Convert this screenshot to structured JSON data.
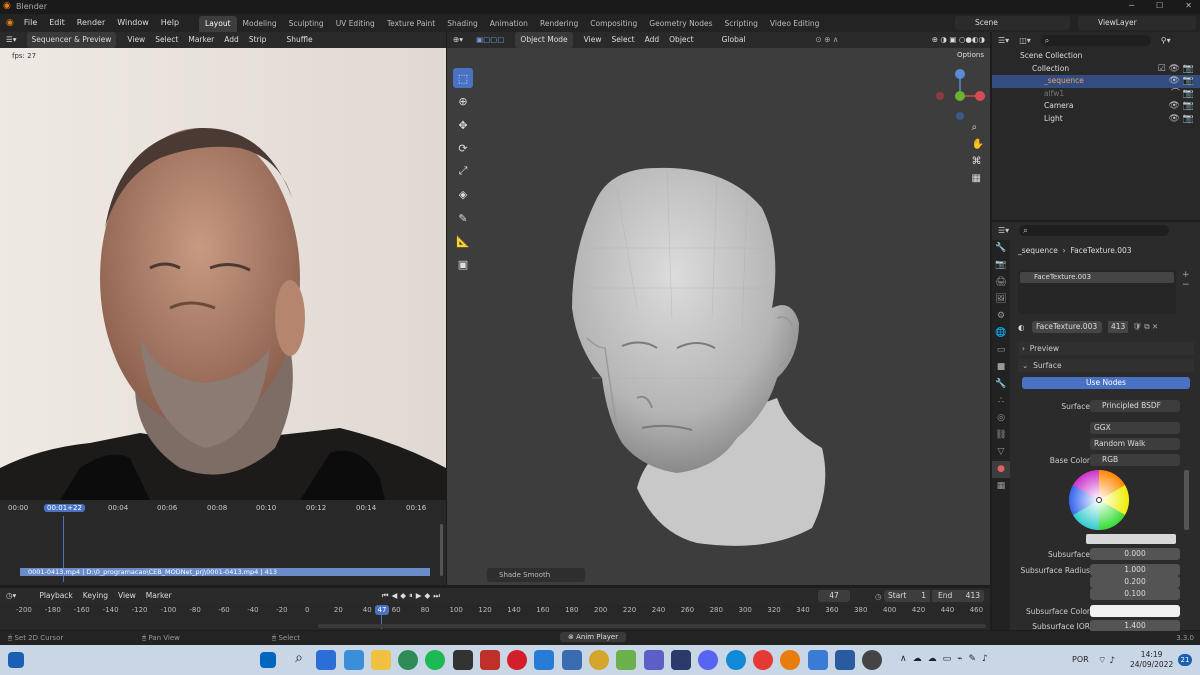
{
  "app": {
    "title": "Blender",
    "version": "3.3.0"
  },
  "menu": [
    "File",
    "Edit",
    "Render",
    "Window",
    "Help"
  ],
  "workspaces": [
    "Layout",
    "Modeling",
    "Sculpting",
    "UV Editing",
    "Texture Paint",
    "Shading",
    "Animation",
    "Rendering",
    "Compositing",
    "Geometry Nodes",
    "Scripting",
    "Video Editing"
  ],
  "active_workspace": "Layout",
  "scene": "Scene",
  "viewlayer": "ViewLayer",
  "seq": {
    "mode": "Sequencer & Preview",
    "menus": [
      "View",
      "Select",
      "Marker",
      "Add",
      "Strip"
    ],
    "shuffle": "Shuffle",
    "fps": "fps: 27",
    "ticks": [
      "00:00",
      "00:01+22",
      "00:04",
      "00:06",
      "00:08",
      "00:10",
      "00:12",
      "00:14",
      "00:16"
    ],
    "strip": "0001-0413.mp4 | D:\\0_programacao\\CEB_MODNet_prj\\0001-0413.mp4 | 413"
  },
  "vp": {
    "mode": "Object Mode",
    "menus": [
      "View",
      "Select",
      "Add",
      "Object"
    ],
    "orient": "Global",
    "options": "Options",
    "shade_popup": "Shade Smooth"
  },
  "outliner": {
    "root": "Scene Collection",
    "collection": "Collection",
    "items": [
      "_sequence",
      "alfw1",
      "Camera",
      "Light"
    ]
  },
  "props": {
    "object": "_sequence",
    "material": "FaceTexture.003",
    "slot": "FaceTexture.003",
    "users": "413",
    "preview": "Preview",
    "surface_hdr": "Surface",
    "use_nodes": "Use Nodes",
    "surface_label": "Surface",
    "surface_val": "Principled BSDF",
    "dist": "GGX",
    "sss_method": "Random Walk",
    "basecolor_label": "Base Color",
    "basecolor_val": "RGB",
    "subsurface_label": "Subsurface",
    "subsurface_val": "0.000",
    "ssr_label": "Subsurface Radius",
    "ssr": [
      "1.000",
      "0.200",
      "0.100"
    ],
    "ssc_label": "Subsurface Color",
    "ssior_label": "Subsurface IOR",
    "ssior_val": "1.400"
  },
  "timeline": {
    "menus": [
      "Playback",
      "Keying",
      "View",
      "Marker"
    ],
    "frame": "47",
    "start_label": "Start",
    "start": "1",
    "end_label": "End",
    "end": "413",
    "ticks": [
      "-200",
      "-180",
      "-160",
      "-140",
      "-120",
      "-100",
      "-80",
      "-60",
      "-40",
      "-20",
      "0",
      "20",
      "40",
      "60",
      "80",
      "100",
      "120",
      "140",
      "160",
      "180",
      "200",
      "220",
      "240",
      "260",
      "280",
      "300",
      "320",
      "340",
      "360",
      "380",
      "400",
      "420",
      "440",
      "460"
    ]
  },
  "status": {
    "left": "Set 2D Cursor",
    "mid": "Pan View",
    "right": "Select",
    "anim": "Anim Player"
  },
  "taskbar": {
    "lang": "POR",
    "time": "14:19",
    "date": "24/09/2022",
    "badge": "21"
  }
}
